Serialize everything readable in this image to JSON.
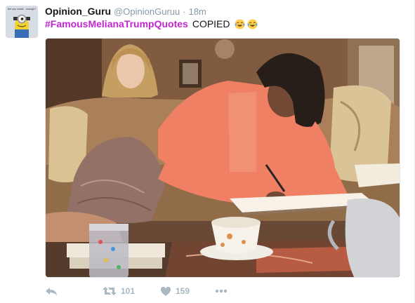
{
  "tweet": {
    "display_name": "Opinion_Guru",
    "handle": "@OpinionGuruu",
    "separator": "·",
    "time": "18m",
    "hashtag": "#FamousMelianaTrumpQuotes",
    "text": "COPIED",
    "emoji": [
      "face-with-tears-of-joy",
      "face-with-tears-of-joy"
    ],
    "avatar_caption": "Are you smart... enough?"
  },
  "actions": {
    "reply_icon": "reply-icon",
    "retweet_icon": "retweet-icon",
    "retweet_count": "101",
    "like_icon": "heart-icon",
    "like_count": "159",
    "more_icon": "more-dots-icon"
  },
  "colors": {
    "hashtag": "#c225d0",
    "meta_gray": "#8899a6",
    "action_gray": "#aab8c2",
    "name": "#14171a"
  }
}
